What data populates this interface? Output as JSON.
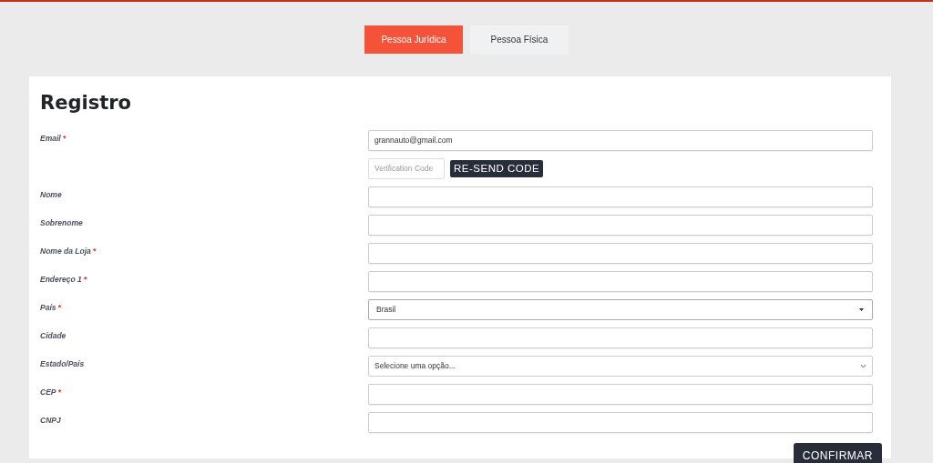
{
  "tabs": [
    {
      "label": "Pessoa Jurídica",
      "selected": true
    },
    {
      "label": "Pessoa Física",
      "selected": false
    }
  ],
  "form": {
    "title": "Registro",
    "fields": [
      {
        "label": "Email",
        "required_mark": "*",
        "kind": "text",
        "value": "grannauto@gmail.com"
      },
      {
        "kind": "verification",
        "placeholder": "Verification Code",
        "button": "RE-SEND CODE"
      },
      {
        "label": "Nome",
        "kind": "text"
      },
      {
        "label": "Sobrenome",
        "kind": "text"
      },
      {
        "label": "Nome da Loja",
        "required_mark": "*",
        "kind": "text"
      },
      {
        "label": "Endereço 1",
        "required_mark": "*",
        "kind": "text"
      },
      {
        "label": "País",
        "required_mark": "*",
        "kind": "select",
        "value": "Brasil"
      },
      {
        "label": "Cidade",
        "kind": "text"
      },
      {
        "label": "Estado/País",
        "kind": "select-light",
        "value": "Selecione uma opção..."
      },
      {
        "label": "CEP",
        "required_mark": "*",
        "kind": "text"
      },
      {
        "label": "CNPJ",
        "kind": "text"
      }
    ],
    "submit": "CONFIRMAR"
  }
}
